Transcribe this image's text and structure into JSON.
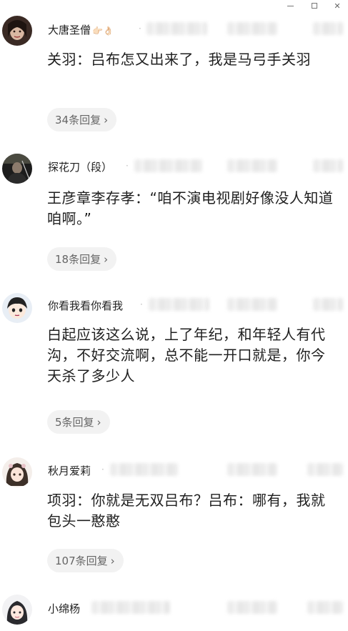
{
  "window": {
    "controls": {
      "minimize": "minimize",
      "maximize": "maximize",
      "close": "close"
    }
  },
  "comments": [
    {
      "username": "大唐圣僧",
      "username_emoji": "👉🏻👌🏻",
      "text": "关羽：吕布怎又出来了，我是马弓手关羽",
      "reply_label": "34条回复",
      "avatar_icon": "avatar-woman-dark-hair"
    },
    {
      "username": "探花刀（段）",
      "username_emoji": "",
      "text": "王彦章李存孝：“咱不演电视剧好像没人知道咱啊。”",
      "reply_label": "18条回复",
      "avatar_icon": "avatar-dark-figure"
    },
    {
      "username": "你看我看你看我",
      "username_emoji": "",
      "text": "白起应该这么说，上了年纪，和年轻人有代沟，不好交流啊，总不能一开口就是，你今天杀了多少人",
      "reply_label": "5条回复",
      "avatar_icon": "avatar-cartoon-boy"
    },
    {
      "username": "秋月爱莉",
      "username_emoji": "",
      "text": "项羽：你就是无双吕布？吕布：哪有，我就包头一憨憨",
      "reply_label": "107条回复",
      "avatar_icon": "avatar-anime-girl"
    },
    {
      "username": "小绵杨",
      "username_emoji": "",
      "text": "",
      "reply_label": "",
      "avatar_icon": "avatar-anime-girl-2"
    }
  ],
  "icons": {
    "chevron": "chevron-right-icon"
  }
}
